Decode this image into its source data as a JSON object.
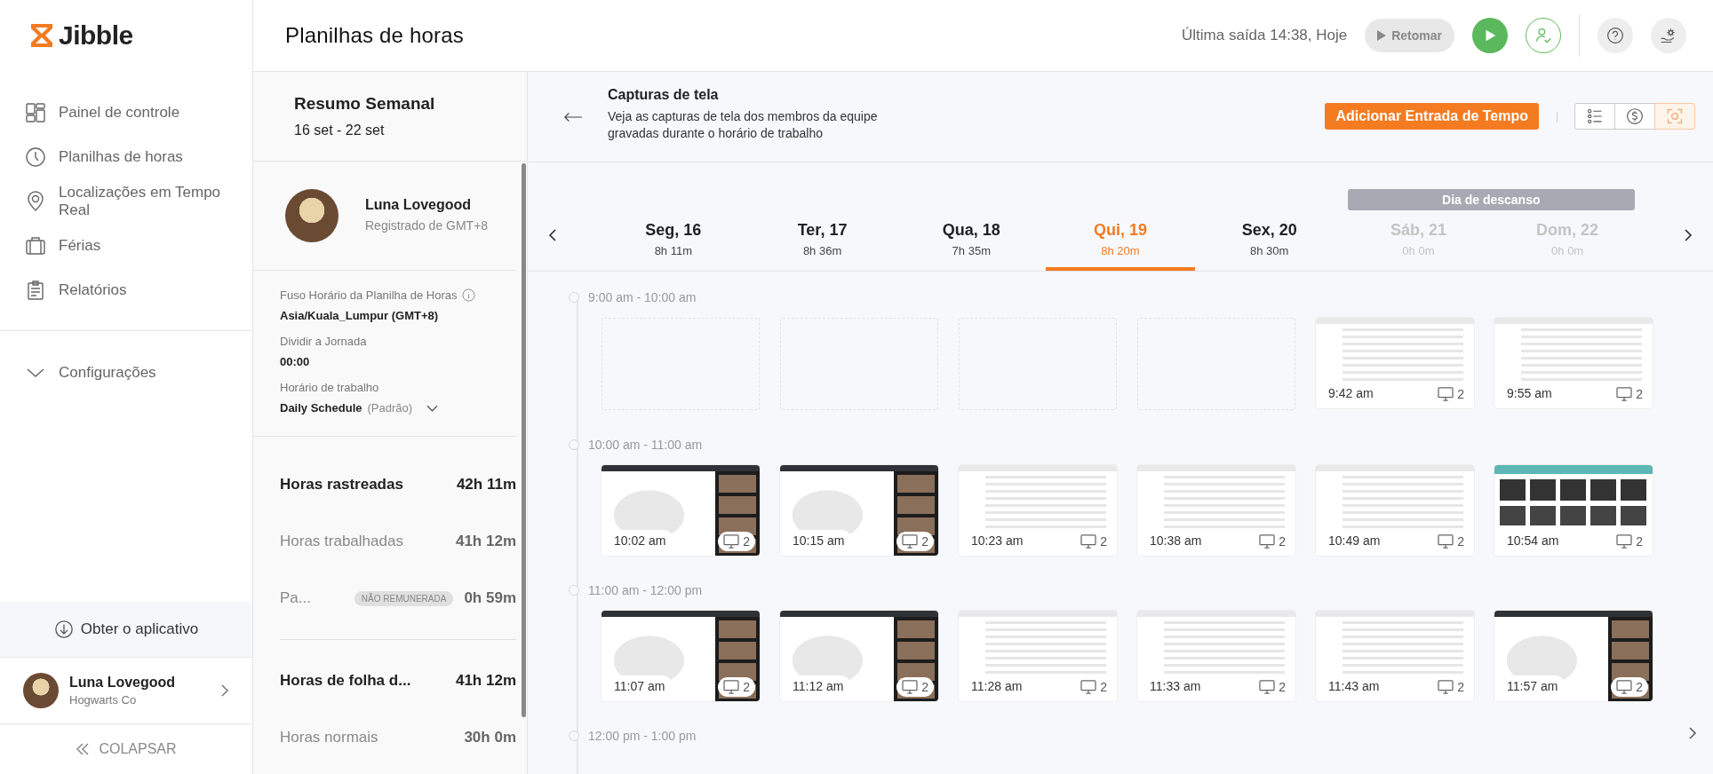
{
  "sidebar": {
    "logo": "Jibble",
    "nav": [
      {
        "label": "Painel de controle"
      },
      {
        "label": "Planilhas de horas"
      },
      {
        "label": "Localizações em Tempo Real"
      },
      {
        "label": "Férias"
      },
      {
        "label": "Relatórios"
      }
    ],
    "settings": {
      "label": "Configurações",
      "expanded": false
    },
    "get_app": "Obter o aplicativo",
    "user": {
      "name": "Luna Lovegood",
      "org": "Hogwarts Co"
    },
    "collapse": "COLAPSAR"
  },
  "header": {
    "title": "Planilhas de horas",
    "last_exit": "Última saída 14:38, Hoje",
    "resume": {
      "label": "Retomar",
      "disabled": true
    }
  },
  "summary": {
    "title": "Resumo Semanal",
    "range": "16 set - 22 set",
    "profile": {
      "name": "Luna Lovegood",
      "note": "Registrado de GMT+8"
    },
    "timezone": {
      "label": "Fuso Horário da Planilha de Horas",
      "value": "Asia/Kuala_Lumpur (GMT+8)"
    },
    "split_day": {
      "label": "Dividir a Jornada",
      "value": "00:00"
    },
    "schedule": {
      "label": "Horário de trabalho",
      "value": "Daily Schedule",
      "note": "(Padrão)"
    },
    "stats": [
      {
        "kind": "total",
        "label": "Horas rastreadas",
        "value": "42h 11m"
      },
      {
        "kind": "sub",
        "label": "Horas trabalhadas",
        "value": "41h 12m"
      },
      {
        "kind": "sub",
        "label": "Pa...",
        "badge": "NÃO REMUNERADA",
        "value": "0h 59m"
      },
      {
        "kind": "rule"
      },
      {
        "kind": "total",
        "label": "Horas de folha d...",
        "value": "41h 12m"
      },
      {
        "kind": "sub",
        "label": "Horas normais",
        "value": "30h 0m"
      }
    ]
  },
  "main": {
    "title": "Capturas de tela",
    "description": "Veja as capturas de tela dos membros da equipe gravadas durante o horário de trabalho",
    "add_button": "Adicionar Entrada de Tempo",
    "views": [
      {
        "selected": false
      },
      {
        "selected": false
      },
      {
        "selected": true
      }
    ],
    "rest_label": "Dia de descanso",
    "days": [
      {
        "label": "Seg, 16",
        "hours": "8h 11m",
        "selected": false,
        "rest": false
      },
      {
        "label": "Ter, 17",
        "hours": "8h 36m",
        "selected": false,
        "rest": false
      },
      {
        "label": "Qua, 18",
        "hours": "7h 35m",
        "selected": false,
        "rest": false
      },
      {
        "label": "Qui, 19",
        "hours": "8h 20m",
        "selected": true,
        "rest": false
      },
      {
        "label": "Sex, 20",
        "hours": "8h 30m",
        "selected": false,
        "rest": false
      },
      {
        "label": "Sáb, 21",
        "hours": "0h 0m",
        "selected": false,
        "rest": true
      },
      {
        "label": "Dom, 22",
        "hours": "0h 0m",
        "selected": false,
        "rest": true
      }
    ],
    "groups": [
      {
        "range": "9:00 am - 10:00 am",
        "shots": [
          {
            "kind": "empty"
          },
          {
            "kind": "empty"
          },
          {
            "kind": "empty"
          },
          {
            "kind": "empty"
          },
          {
            "kind": "email",
            "time": "9:42 am",
            "screens": "2"
          },
          {
            "kind": "email",
            "time": "9:55 am",
            "screens": "2"
          }
        ]
      },
      {
        "range": "10:00 am - 11:00 am",
        "shots": [
          {
            "kind": "meeting",
            "time": "10:02 am",
            "screens": "2"
          },
          {
            "kind": "meeting",
            "time": "10:15 am",
            "screens": "2"
          },
          {
            "kind": "email",
            "time": "10:23 am",
            "screens": "2"
          },
          {
            "kind": "email",
            "time": "10:38 am",
            "screens": "2"
          },
          {
            "kind": "email",
            "time": "10:49 am",
            "screens": "2"
          },
          {
            "kind": "gallery",
            "time": "10:54 am",
            "screens": "2"
          }
        ]
      },
      {
        "range": "11:00 am - 12:00 pm",
        "shots": [
          {
            "kind": "meeting",
            "time": "11:07 am",
            "screens": "2"
          },
          {
            "kind": "meeting",
            "time": "11:12 am",
            "screens": "2"
          },
          {
            "kind": "email",
            "time": "11:28 am",
            "screens": "2"
          },
          {
            "kind": "email",
            "time": "11:33 am",
            "screens": "2"
          },
          {
            "kind": "email",
            "time": "11:43 am",
            "screens": "2"
          },
          {
            "kind": "meeting",
            "time": "11:57 am",
            "screens": "2"
          }
        ]
      },
      {
        "range": "12:00 pm - 1:00 pm"
      }
    ]
  }
}
